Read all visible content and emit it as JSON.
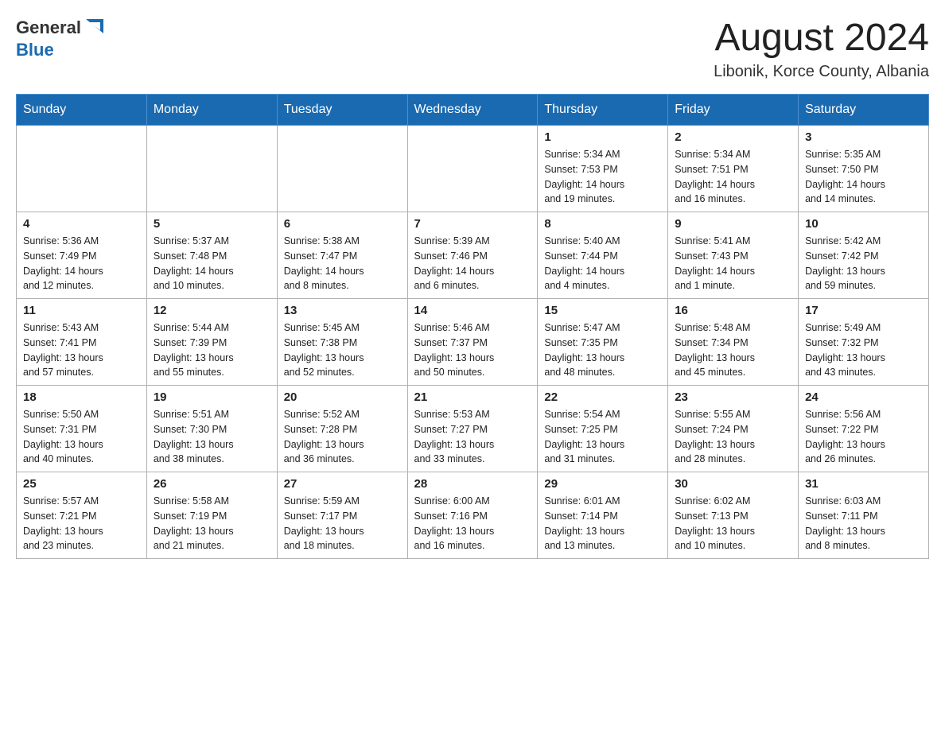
{
  "header": {
    "logo_general": "General",
    "logo_blue": "Blue",
    "month_title": "August 2024",
    "location": "Libonik, Korce County, Albania"
  },
  "weekdays": [
    "Sunday",
    "Monday",
    "Tuesday",
    "Wednesday",
    "Thursday",
    "Friday",
    "Saturday"
  ],
  "weeks": [
    [
      {
        "day": "",
        "info": ""
      },
      {
        "day": "",
        "info": ""
      },
      {
        "day": "",
        "info": ""
      },
      {
        "day": "",
        "info": ""
      },
      {
        "day": "1",
        "info": "Sunrise: 5:34 AM\nSunset: 7:53 PM\nDaylight: 14 hours\nand 19 minutes."
      },
      {
        "day": "2",
        "info": "Sunrise: 5:34 AM\nSunset: 7:51 PM\nDaylight: 14 hours\nand 16 minutes."
      },
      {
        "day": "3",
        "info": "Sunrise: 5:35 AM\nSunset: 7:50 PM\nDaylight: 14 hours\nand 14 minutes."
      }
    ],
    [
      {
        "day": "4",
        "info": "Sunrise: 5:36 AM\nSunset: 7:49 PM\nDaylight: 14 hours\nand 12 minutes."
      },
      {
        "day": "5",
        "info": "Sunrise: 5:37 AM\nSunset: 7:48 PM\nDaylight: 14 hours\nand 10 minutes."
      },
      {
        "day": "6",
        "info": "Sunrise: 5:38 AM\nSunset: 7:47 PM\nDaylight: 14 hours\nand 8 minutes."
      },
      {
        "day": "7",
        "info": "Sunrise: 5:39 AM\nSunset: 7:46 PM\nDaylight: 14 hours\nand 6 minutes."
      },
      {
        "day": "8",
        "info": "Sunrise: 5:40 AM\nSunset: 7:44 PM\nDaylight: 14 hours\nand 4 minutes."
      },
      {
        "day": "9",
        "info": "Sunrise: 5:41 AM\nSunset: 7:43 PM\nDaylight: 14 hours\nand 1 minute."
      },
      {
        "day": "10",
        "info": "Sunrise: 5:42 AM\nSunset: 7:42 PM\nDaylight: 13 hours\nand 59 minutes."
      }
    ],
    [
      {
        "day": "11",
        "info": "Sunrise: 5:43 AM\nSunset: 7:41 PM\nDaylight: 13 hours\nand 57 minutes."
      },
      {
        "day": "12",
        "info": "Sunrise: 5:44 AM\nSunset: 7:39 PM\nDaylight: 13 hours\nand 55 minutes."
      },
      {
        "day": "13",
        "info": "Sunrise: 5:45 AM\nSunset: 7:38 PM\nDaylight: 13 hours\nand 52 minutes."
      },
      {
        "day": "14",
        "info": "Sunrise: 5:46 AM\nSunset: 7:37 PM\nDaylight: 13 hours\nand 50 minutes."
      },
      {
        "day": "15",
        "info": "Sunrise: 5:47 AM\nSunset: 7:35 PM\nDaylight: 13 hours\nand 48 minutes."
      },
      {
        "day": "16",
        "info": "Sunrise: 5:48 AM\nSunset: 7:34 PM\nDaylight: 13 hours\nand 45 minutes."
      },
      {
        "day": "17",
        "info": "Sunrise: 5:49 AM\nSunset: 7:32 PM\nDaylight: 13 hours\nand 43 minutes."
      }
    ],
    [
      {
        "day": "18",
        "info": "Sunrise: 5:50 AM\nSunset: 7:31 PM\nDaylight: 13 hours\nand 40 minutes."
      },
      {
        "day": "19",
        "info": "Sunrise: 5:51 AM\nSunset: 7:30 PM\nDaylight: 13 hours\nand 38 minutes."
      },
      {
        "day": "20",
        "info": "Sunrise: 5:52 AM\nSunset: 7:28 PM\nDaylight: 13 hours\nand 36 minutes."
      },
      {
        "day": "21",
        "info": "Sunrise: 5:53 AM\nSunset: 7:27 PM\nDaylight: 13 hours\nand 33 minutes."
      },
      {
        "day": "22",
        "info": "Sunrise: 5:54 AM\nSunset: 7:25 PM\nDaylight: 13 hours\nand 31 minutes."
      },
      {
        "day": "23",
        "info": "Sunrise: 5:55 AM\nSunset: 7:24 PM\nDaylight: 13 hours\nand 28 minutes."
      },
      {
        "day": "24",
        "info": "Sunrise: 5:56 AM\nSunset: 7:22 PM\nDaylight: 13 hours\nand 26 minutes."
      }
    ],
    [
      {
        "day": "25",
        "info": "Sunrise: 5:57 AM\nSunset: 7:21 PM\nDaylight: 13 hours\nand 23 minutes."
      },
      {
        "day": "26",
        "info": "Sunrise: 5:58 AM\nSunset: 7:19 PM\nDaylight: 13 hours\nand 21 minutes."
      },
      {
        "day": "27",
        "info": "Sunrise: 5:59 AM\nSunset: 7:17 PM\nDaylight: 13 hours\nand 18 minutes."
      },
      {
        "day": "28",
        "info": "Sunrise: 6:00 AM\nSunset: 7:16 PM\nDaylight: 13 hours\nand 16 minutes."
      },
      {
        "day": "29",
        "info": "Sunrise: 6:01 AM\nSunset: 7:14 PM\nDaylight: 13 hours\nand 13 minutes."
      },
      {
        "day": "30",
        "info": "Sunrise: 6:02 AM\nSunset: 7:13 PM\nDaylight: 13 hours\nand 10 minutes."
      },
      {
        "day": "31",
        "info": "Sunrise: 6:03 AM\nSunset: 7:11 PM\nDaylight: 13 hours\nand 8 minutes."
      }
    ]
  ]
}
